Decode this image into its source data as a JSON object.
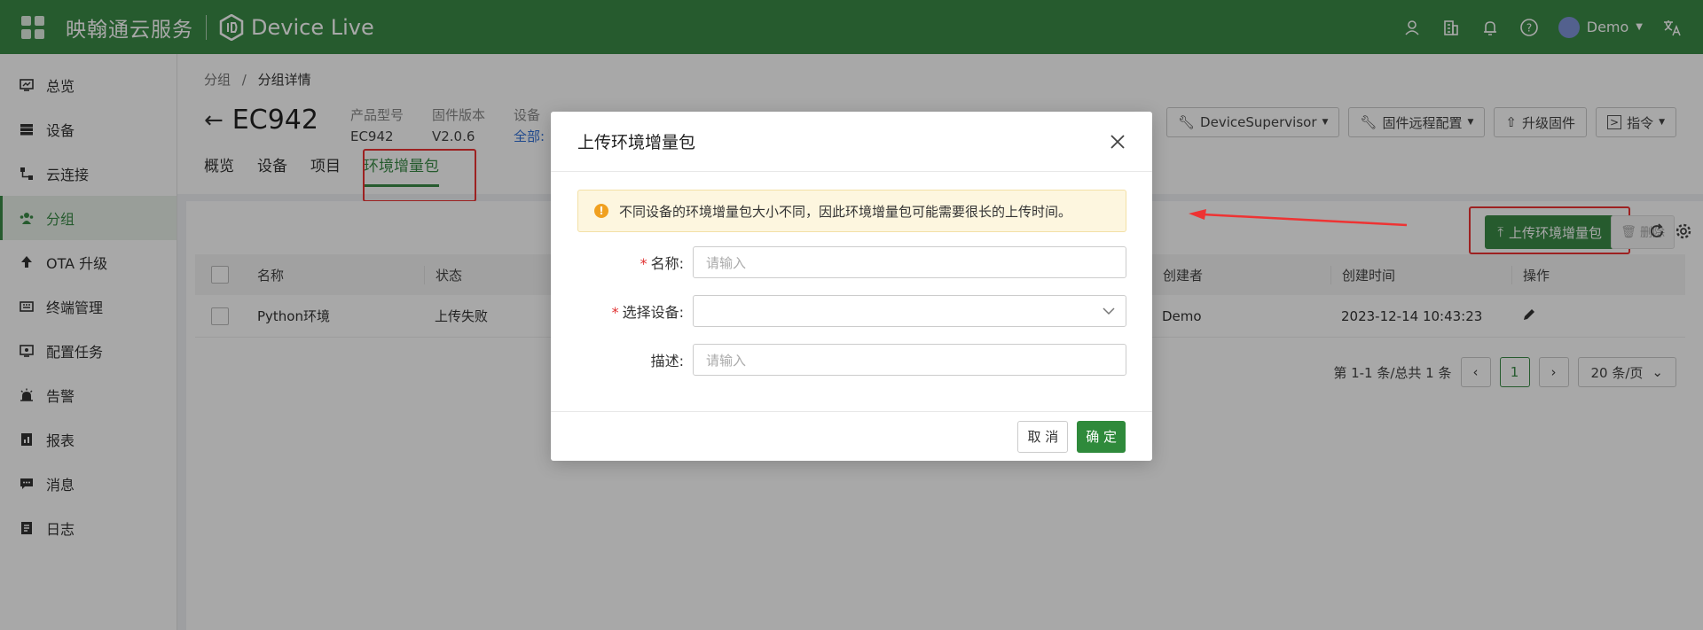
{
  "topbar": {
    "brand": "映翰通云服务",
    "product": "Device Live",
    "user": "Demo",
    "icons": [
      "users-icon",
      "building-icon",
      "bell-icon",
      "help-icon",
      "translate-icon"
    ]
  },
  "sidebar": {
    "items": [
      {
        "label": "总览",
        "icon": "dashboard-icon"
      },
      {
        "label": "设备",
        "icon": "server-icon"
      },
      {
        "label": "云连接",
        "icon": "cloud-connect-icon"
      },
      {
        "label": "分组",
        "icon": "group-icon"
      },
      {
        "label": "OTA 升级",
        "icon": "upload-icon"
      },
      {
        "label": "终端管理",
        "icon": "terminal-icon"
      },
      {
        "label": "配置任务",
        "icon": "config-icon"
      },
      {
        "label": "告警",
        "icon": "alarm-icon"
      },
      {
        "label": "报表",
        "icon": "report-icon"
      },
      {
        "label": "消息",
        "icon": "message-icon"
      },
      {
        "label": "日志",
        "icon": "log-icon"
      }
    ],
    "active": "分组"
  },
  "breadcrumb": {
    "root": "分组",
    "sep": "/",
    "current": "分组详情"
  },
  "device": {
    "title": "EC942",
    "meta": [
      {
        "k": "产品型号",
        "v": "EC942"
      },
      {
        "k": "固件版本",
        "v": "V2.0.6"
      },
      {
        "k": "设备",
        "v": "全部:"
      }
    ]
  },
  "tabs": [
    "概览",
    "设备",
    "项目",
    "环境增量包"
  ],
  "actions": {
    "supervisor": "DeviceSupervisor",
    "remote_config": "固件远程配置",
    "upgrade": "升级固件",
    "command": "指令",
    "upload": "上传环境增量包",
    "delete": "删除"
  },
  "table": {
    "headers": [
      "名称",
      "状态",
      "创建者",
      "创建时间",
      "操作"
    ],
    "rows": [
      {
        "name": "Python环境",
        "status": "上传失败",
        "creator": "Demo",
        "time": "2023-12-14 10:43:23"
      }
    ]
  },
  "pager": {
    "summary": "第 1-1 条/总共 1 条",
    "page": "1",
    "size": "20 条/页"
  },
  "modal": {
    "title": "上传环境增量包",
    "alert": "不同设备的环境增量包大小不同，因此环境增量包可能需要很长的上传时间。",
    "fields": {
      "name_label": "名称:",
      "name_placeholder": "请输入",
      "device_label": "选择设备:",
      "desc_label": "描述:",
      "desc_placeholder": "请输入"
    },
    "cancel": "取 消",
    "ok": "确 定"
  },
  "colors": {
    "brand_green": "#3a8a47",
    "highlight_red": "#ee3333"
  }
}
